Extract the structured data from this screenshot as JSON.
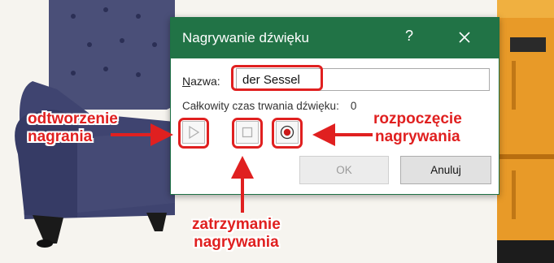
{
  "dialog": {
    "title": "Nagrywanie dźwięku",
    "help_symbol": "?",
    "name_label_underlined": "N",
    "name_label_rest": "azwa:",
    "name_value": "der Sessel",
    "duration_label": "Całkowity czas trwania dźwięku:",
    "duration_value": "0",
    "ok_label": "OK",
    "cancel_label": "Anuluj"
  },
  "annotations": {
    "play": [
      "odtworzenie",
      "nagrania"
    ],
    "record": [
      "rozpoczęcie",
      "nagrywania"
    ],
    "stop": [
      "zatrzymanie",
      "nagrywania"
    ]
  },
  "colors": {
    "titlebar": "#217346",
    "annotation": "#e02020"
  }
}
